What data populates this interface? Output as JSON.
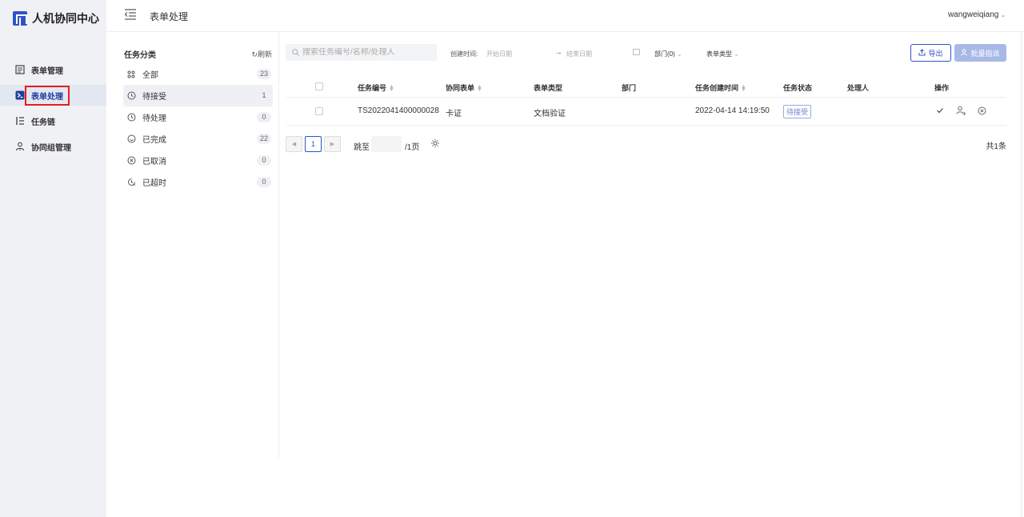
{
  "app": {
    "name": "人机协同中心"
  },
  "nav": {
    "items": [
      {
        "label": "表单管理",
        "icon": "form-icon",
        "active": false
      },
      {
        "label": "表单处理",
        "icon": "form-process-icon",
        "active": true
      },
      {
        "label": "任务链",
        "icon": "task-chain-icon",
        "active": false
      },
      {
        "label": "协同组管理",
        "icon": "group-icon",
        "active": false
      }
    ]
  },
  "header": {
    "title": "表单处理",
    "user": "wangweiqiang"
  },
  "categories": {
    "title": "任务分类",
    "refresh_label": "刷新",
    "items": [
      {
        "label": "全部",
        "count": "23",
        "icon": "grid-icon"
      },
      {
        "label": "待接受",
        "count": "1",
        "icon": "clock-icon"
      },
      {
        "label": "待处理",
        "count": "0",
        "icon": "clock-icon"
      },
      {
        "label": "已完成",
        "count": "22",
        "icon": "smile-icon"
      },
      {
        "label": "已取消",
        "count": "0",
        "icon": "x-circle-icon"
      },
      {
        "label": "已超时",
        "count": "0",
        "icon": "timeout-icon"
      }
    ]
  },
  "filters": {
    "search_placeholder": "搜索任务编号/名称/处理人",
    "created_time_label": "创建时间:",
    "start_placeholder": "开始日期",
    "arrow": "→",
    "end_placeholder": "结束日期",
    "department_label": "部门(0)",
    "form_type_label": "表单类型",
    "export_label": "导出",
    "batch_label": "批量指派"
  },
  "table": {
    "columns": [
      "任务编号",
      "协同表单",
      "表单类型",
      "部门",
      "任务创建时间",
      "任务状态",
      "处理人",
      "操作"
    ],
    "rows": [
      {
        "task_id": "TS2022041400000028",
        "form": "卡证",
        "form_type": "文档验证",
        "department": "",
        "created": "2022-04-14 14:19:50",
        "status": "待接受",
        "handler": ""
      }
    ]
  },
  "pagination": {
    "current": "1",
    "jump_label": "跳至",
    "total_pages": "/1页",
    "total": "共1条"
  },
  "colors": {
    "accent": "#2f54c9",
    "highlight": "#e02020"
  }
}
